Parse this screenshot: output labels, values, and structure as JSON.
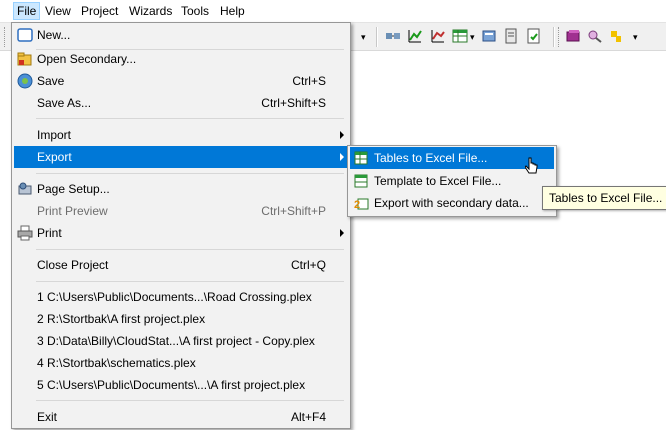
{
  "menubar": {
    "items": [
      {
        "label": "File"
      },
      {
        "label": "View"
      },
      {
        "label": "Project"
      },
      {
        "label": "Wizards"
      },
      {
        "label": "Tools"
      },
      {
        "label": "Help"
      }
    ]
  },
  "file_menu": {
    "new": {
      "label": "New..."
    },
    "open_secondary": {
      "label": "Open Secondary..."
    },
    "save": {
      "label": "Save",
      "shortcut": "Ctrl+S"
    },
    "save_as": {
      "label": "Save As...",
      "shortcut": "Ctrl+Shift+S"
    },
    "import": {
      "label": "Import"
    },
    "export": {
      "label": "Export"
    },
    "page_setup": {
      "label": "Page Setup..."
    },
    "print_preview": {
      "label": "Print Preview",
      "shortcut": "Ctrl+Shift+P"
    },
    "print": {
      "label": "Print"
    },
    "close_project": {
      "label": "Close Project",
      "shortcut": "Ctrl+Q"
    },
    "recent": [
      {
        "label": "1 C:\\Users\\Public\\Documents...\\Road Crossing.plex"
      },
      {
        "label": "2 R:\\Stortbak\\A first project.plex"
      },
      {
        "label": "3 D:\\Data\\Billy\\CloudStat...\\A first project - Copy.plex"
      },
      {
        "label": "4 R:\\Stortbak\\schematics.plex"
      },
      {
        "label": "5 C:\\Users\\Public\\Documents\\...\\A first project.plex"
      }
    ],
    "exit": {
      "label": "Exit",
      "shortcut": "Alt+F4"
    }
  },
  "export_submenu": {
    "items": [
      {
        "label": "Tables to Excel File..."
      },
      {
        "label": "Template to Excel File..."
      },
      {
        "label": "Export with secondary data..."
      }
    ]
  },
  "tooltip": {
    "text": "Tables to Excel File..."
  },
  "colors": {
    "highlight": "#0078d7",
    "menu_bg": "#f2f2f2",
    "tooltip_bg": "#ffffe1"
  }
}
